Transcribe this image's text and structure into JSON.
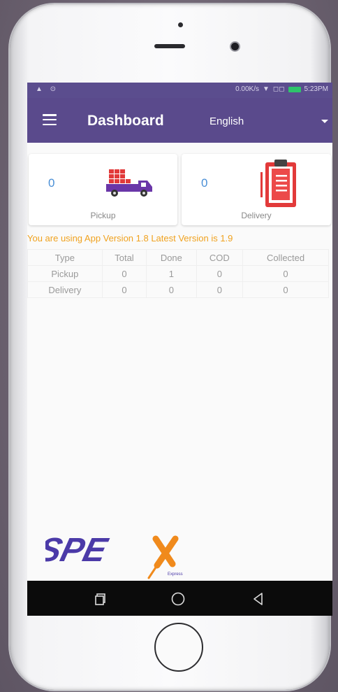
{
  "statusbar": {
    "left": "▲ ⊙",
    "network": "0.00K/s",
    "time": "5:23PM"
  },
  "appbar": {
    "title": "Dashboard",
    "language": "English"
  },
  "cards": {
    "pickup": {
      "count": "0",
      "label": "Pickup"
    },
    "delivery": {
      "count": "0",
      "label": "Delivery"
    }
  },
  "version_notice": "You are using App Version 1.8 Latest Version is 1.9",
  "table": {
    "headers": [
      "Type",
      "Total",
      "Done",
      "COD",
      "Collected"
    ],
    "rows": [
      [
        "Pickup",
        "0",
        "1",
        "0",
        "0"
      ],
      [
        "Delivery",
        "0",
        "0",
        "0",
        "0"
      ]
    ]
  },
  "logo": {
    "text": "SPEx",
    "sub": "Express"
  },
  "colors": {
    "appbar": "#5a4a8c",
    "accent_blue": "#4a8fd6",
    "notice_orange": "#f0a21f",
    "logo_purple": "#4b3aa8",
    "logo_orange": "#f08a1c"
  }
}
